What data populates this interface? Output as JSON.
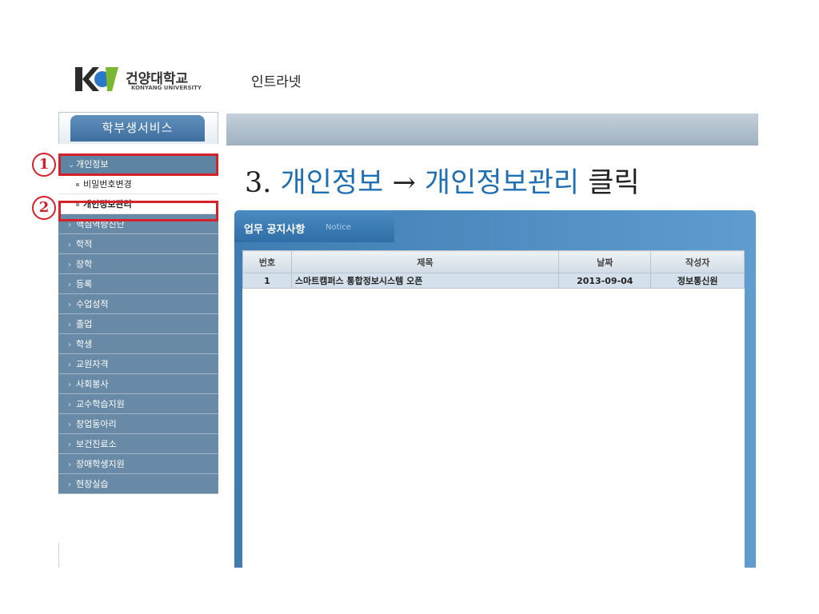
{
  "header": {
    "logo_title": "건양대학교",
    "logo_subtitle": "KONYANG UNIVERSITY",
    "logo_mark": "KY",
    "intranet_label": "인트라넷"
  },
  "sidebar": {
    "tab_label": "학부생서비스",
    "open_item": "개인정보",
    "sub_items": [
      "비밀번호변경",
      "개인정보관리"
    ],
    "items": [
      "핵심역량진단",
      "학적",
      "장학",
      "등록",
      "수업성적",
      "졸업",
      "학생",
      "교원자격",
      "사회봉사",
      "교수학습지원",
      "창업동아리",
      "보건진료소",
      "장애학생지원",
      "현장실습"
    ]
  },
  "annotations": {
    "step1": "1",
    "step2": "2"
  },
  "instruction": {
    "prefix": "3. ",
    "item1": "개인정보",
    "arrow": " → ",
    "item2": "개인정보관리",
    "suffix": " 클릭"
  },
  "notice": {
    "title": "업무 공지사항",
    "subtitle": "Notice",
    "columns": [
      "번호",
      "제목",
      "날짜",
      "작성자"
    ],
    "rows": [
      {
        "num": "1",
        "title": "스마트캠퍼스 통합정보시스템 오픈",
        "date": "2013-09-04",
        "author": "정보통신원"
      }
    ]
  },
  "colors": {
    "highlight_red": "#d8202a",
    "instruction_blue": "#1f6fb5",
    "menu_bg": "#688aa7"
  }
}
